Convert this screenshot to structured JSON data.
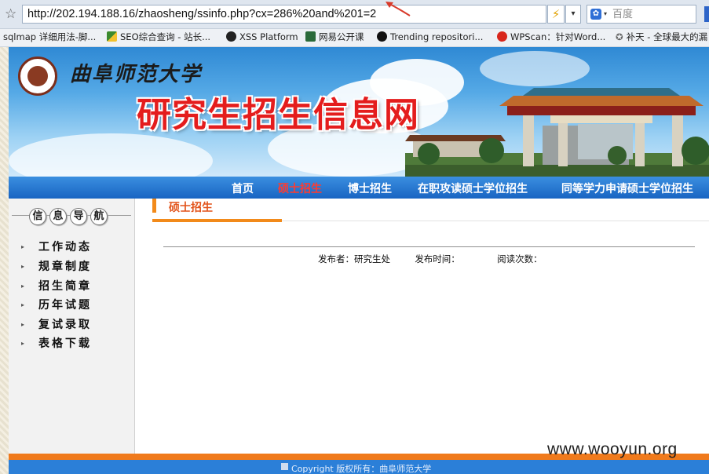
{
  "browser": {
    "url": "http://202.194.188.16/zhaosheng/ssinfo.php?cx=286%20and%201=2",
    "search_placeholder": "百度",
    "colors": {
      "annotation_arrow": "#d83a2a"
    }
  },
  "favorites": [
    {
      "label": "sqlmap 详细用法-脚...",
      "icon": "text-icon"
    },
    {
      "label": "SEO综合查询 - 站长...",
      "icon": "seo-icon"
    },
    {
      "label": "XSS Platform",
      "icon": "xss-icon"
    },
    {
      "label": "网易公开课",
      "icon": "video-icon"
    },
    {
      "label": "Trending repositori...",
      "icon": "github-icon"
    },
    {
      "label": "WPScan：针对Word...",
      "icon": "wpscan-icon"
    },
    {
      "label": "补天 - 全球最大的漏",
      "icon": "star-icon"
    }
  ],
  "banner": {
    "university_name": "曲阜师范大学",
    "site_title": "研究生招生信息网"
  },
  "nav": {
    "items": [
      {
        "label": "首页"
      },
      {
        "label": "硕士招生",
        "active": true
      },
      {
        "label": "博士招生"
      },
      {
        "label": "在职攻读硕士学位招生"
      },
      {
        "label": "同等学力申请硕士学位招生"
      }
    ],
    "active_color": "#ff3b2f"
  },
  "sidebar": {
    "title_chars": [
      "信",
      "息",
      "导",
      "航"
    ],
    "items": [
      "工作动态",
      "规章制度",
      "招生简章",
      "历年试题",
      "复试录取",
      "表格下载"
    ]
  },
  "section": {
    "title": "硕士招生"
  },
  "article": {
    "publisher_label": "发布者：研究生处",
    "time_label": "发布时间：",
    "reads_label": "阅读次数："
  },
  "footer": {
    "text": "Copyright 版权所有：曲阜师范大学"
  },
  "watermark": "www.wooyun.org"
}
